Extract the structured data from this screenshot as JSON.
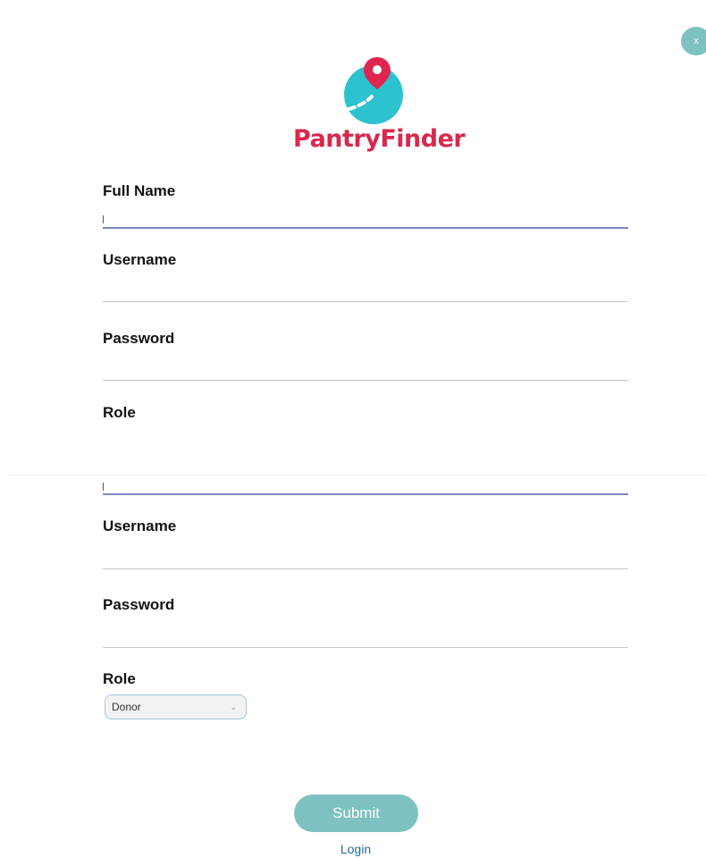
{
  "close": {
    "label": "x"
  },
  "brand": {
    "name": "PantryFinder",
    "text_color": "#d8284e",
    "logo_color": "#2cc3cf",
    "pin_color": "#e0254f"
  },
  "form": {
    "full_name": {
      "label": "Full Name",
      "value": ""
    },
    "username": {
      "label": "Username",
      "value": ""
    },
    "password": {
      "label": "Password",
      "value": ""
    },
    "role": {
      "label": "Role"
    }
  },
  "form_repeat": {
    "username": {
      "label": "Username",
      "value": ""
    },
    "password": {
      "label": "Password",
      "value": ""
    },
    "role": {
      "label": "Role",
      "selected": "Donor"
    }
  },
  "actions": {
    "submit_label": "Submit",
    "login_label": "Login",
    "accent": "#7ec1c1"
  }
}
